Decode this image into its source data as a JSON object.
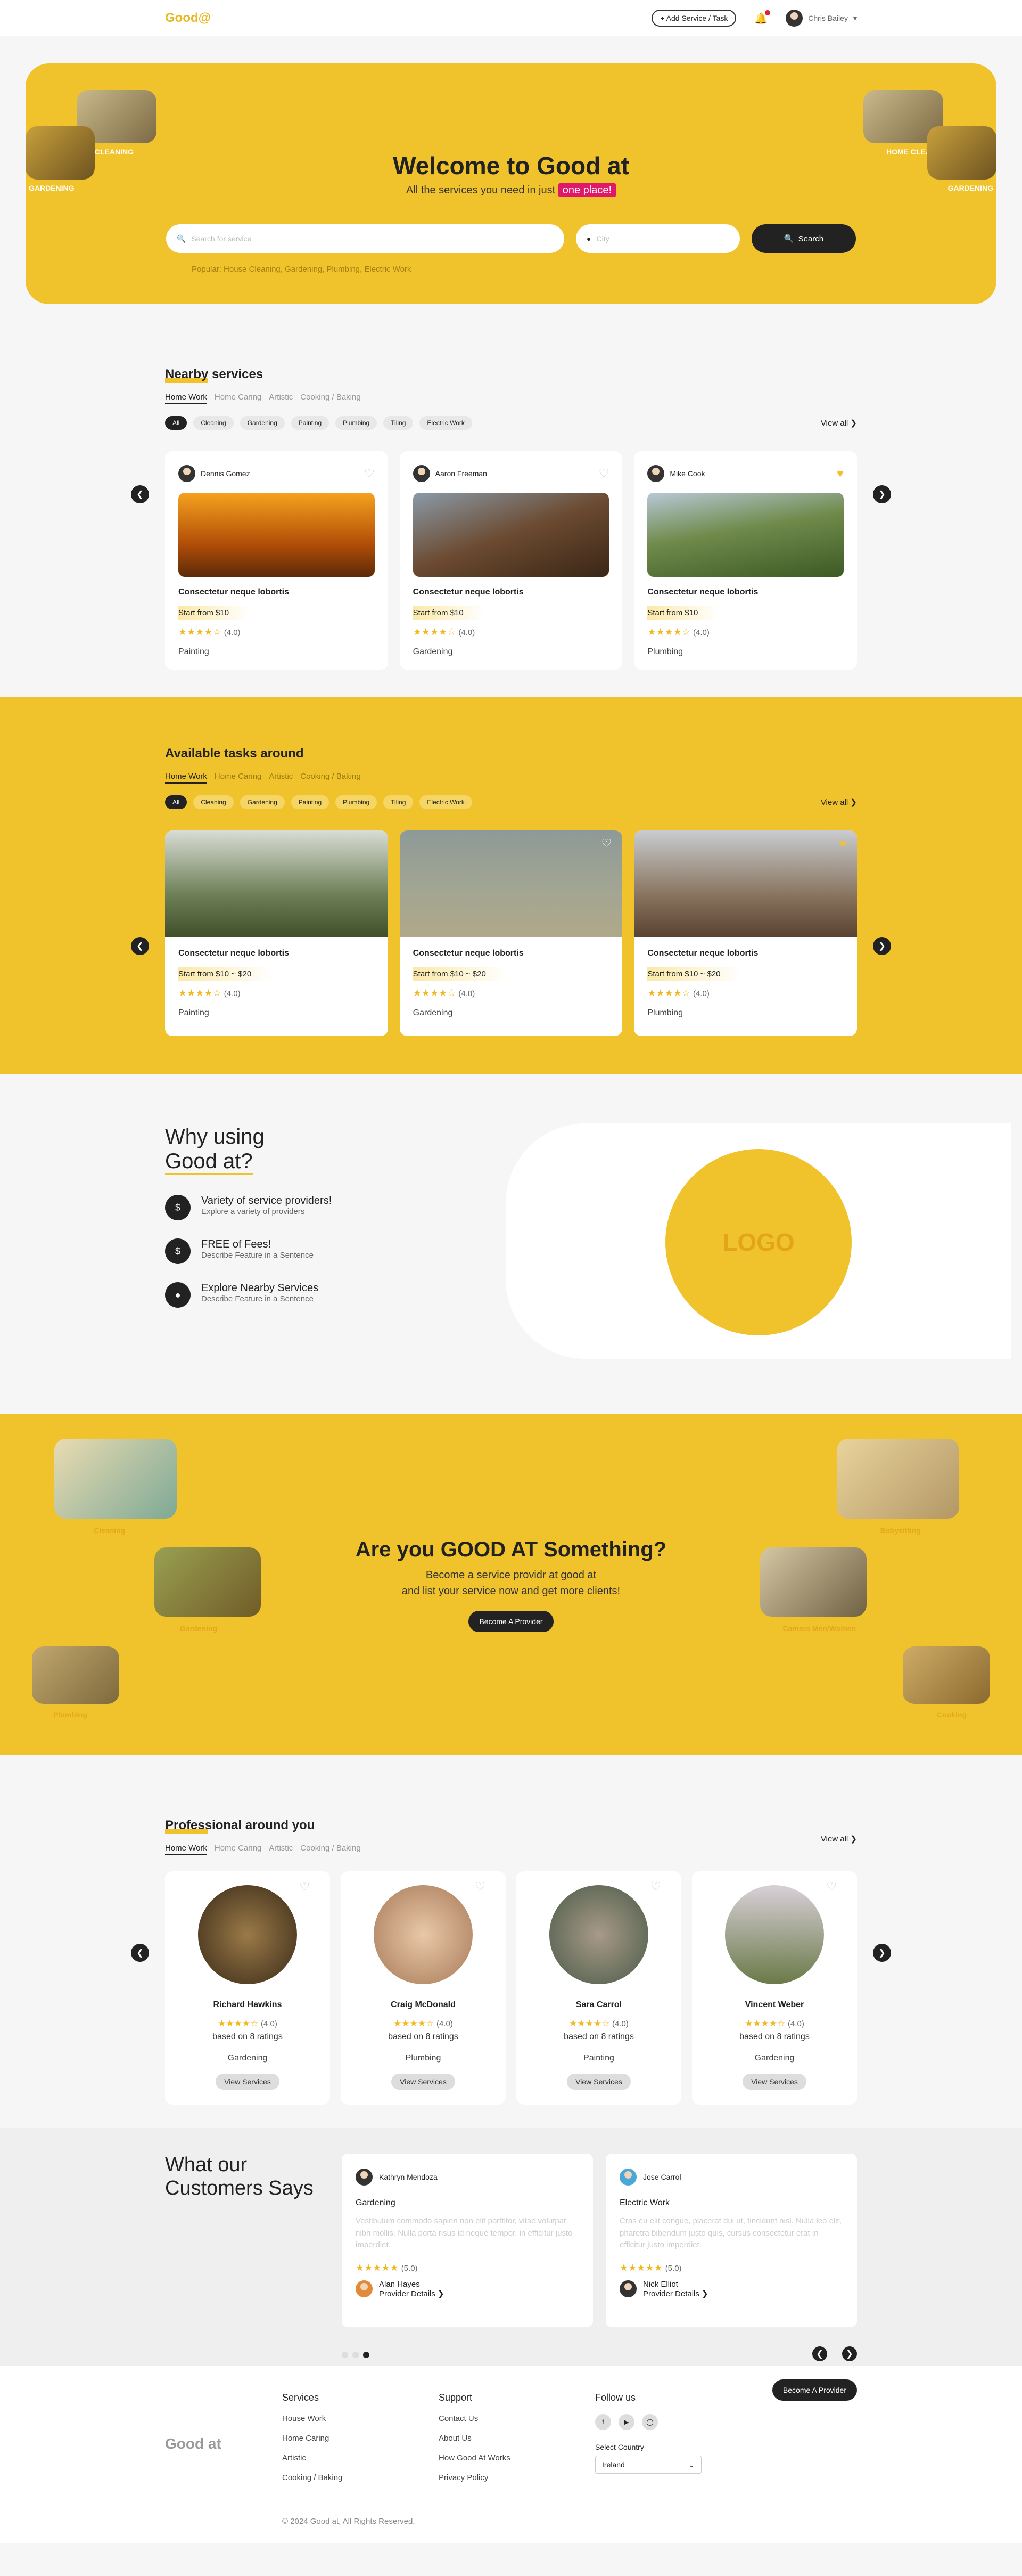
{
  "header": {
    "logo": "Good@",
    "add_service": "+ Add Service / Task",
    "user_name": "Chris Bailey"
  },
  "hero": {
    "title": "Welcome to Good at",
    "subtitle_prefix": "All the services you need in just",
    "subtitle_highlight": "one place!",
    "search_placeholder": "Search for service",
    "city_placeholder": "City",
    "search_button": "Search",
    "popular": "Popular: House Cleaning, Gardening, Plumbing, Electric Work",
    "labels": [
      "HOME CLEANING",
      "GARDENING",
      "HOME CLEANING",
      "GARDENING"
    ]
  },
  "nearby": {
    "title": "Nearby services",
    "tabs": [
      "Home Work",
      "Home Caring",
      "Artistic",
      "Cooking / Baking"
    ],
    "pills": [
      "All",
      "Cleaning",
      "Gardening",
      "Painting",
      "Plumbing",
      "Tiling",
      "Electric Work"
    ],
    "view_all": "View all",
    "cards": [
      {
        "provider": "Dennis Gomez",
        "title": "Consectetur neque lobortis",
        "price": "Start from $10",
        "rating": "(4.0)",
        "category": "Painting",
        "fav": false
      },
      {
        "provider": "Aaron Freeman",
        "title": "Consectetur neque lobortis",
        "price": "Start from $10",
        "rating": "(4.0)",
        "category": "Gardening",
        "fav": false
      },
      {
        "provider": "Mike Cook",
        "title": "Consectetur neque lobortis",
        "price": "Start from $10",
        "rating": "(4.0)",
        "category": "Plumbing",
        "fav": true
      }
    ]
  },
  "tasks": {
    "title": "Available tasks around",
    "tabs": [
      "Home Work",
      "Home Caring",
      "Artistic",
      "Cooking / Baking"
    ],
    "pills": [
      "All",
      "Cleaning",
      "Gardening",
      "Painting",
      "Plumbing",
      "Tiling",
      "Electric Work"
    ],
    "view_all": "View all",
    "cards": [
      {
        "title": "Consectetur neque lobortis",
        "price": "Start from $10 ~ $20",
        "rating": "(4.0)",
        "category": "Painting"
      },
      {
        "title": "Consectetur neque lobortis",
        "price": "Start from $10 ~ $20",
        "rating": "(4.0)",
        "category": "Gardening"
      },
      {
        "title": "Consectetur neque lobortis",
        "price": "Start from $10 ~ $20",
        "rating": "(4.0)",
        "category": "Plumbing"
      }
    ]
  },
  "why": {
    "title_line1": "Why using",
    "title_line2": "Good at?",
    "features": [
      {
        "icon": "$",
        "title": "Variety of service providers!",
        "desc": "Explore a variety of providers"
      },
      {
        "icon": "$",
        "title": "FREE of Fees!",
        "desc": "Describe Feature in a Sentence"
      },
      {
        "icon": "●",
        "title": "Explore Nearby Services",
        "desc": "Describe Feature in a Sentence"
      }
    ],
    "logo_text": "LOGO"
  },
  "goodat": {
    "title": "Are you GOOD AT Something?",
    "line1": "Become a service providr at good at",
    "line2": "and list your service now and get more clients!",
    "button": "Become A Provider",
    "labels": [
      "Cleaning",
      "Gardening",
      "Plumbing",
      "Babysitting",
      "Camera Men/Women",
      "Cooking"
    ]
  },
  "pros": {
    "title": "Professional around you",
    "tabs": [
      "Home Work",
      "Home Caring",
      "Artistic",
      "Cooking / Baking"
    ],
    "view_all": "View all",
    "cards": [
      {
        "name": "Richard Hawkins",
        "rating": "(4.0)",
        "based": "based on 8 ratings",
        "category": "Gardening",
        "button": "View Services"
      },
      {
        "name": "Craig McDonald",
        "rating": "(4.0)",
        "based": "based on 8 ratings",
        "category": "Plumbing",
        "button": "View Services"
      },
      {
        "name": "Sara Carrol",
        "rating": "(4.0)",
        "based": "based on 8 ratings",
        "category": "Painting",
        "button": "View Services"
      },
      {
        "name": "Vincent Weber",
        "rating": "(4.0)",
        "based": "based on 8 ratings",
        "category": "Gardening",
        "button": "View Services"
      }
    ]
  },
  "testimonials": {
    "title_line1": "What our",
    "title_line2": "Customers Says",
    "items": [
      {
        "name": "Kathryn Mendoza",
        "category": "Gardening",
        "text": "Vestibulum commodo sapien non elit porttitor, vitae volutpat nibh mollis. Nulla porta risus id neque tempor, in efficitur justo imperdiet.",
        "rating": "(5.0)",
        "provider": "Alan Hayes",
        "details": "Provider Details"
      },
      {
        "name": "Jose Carrol",
        "category": "Electric Work",
        "text": "Cras eu elit congue, placerat dui ut, tincidunt nisl. Nulla leo elit, pharetra bibendum justo quis, cursus consectetur erat in efficitur justo imperdiet.",
        "rating": "(5.0)",
        "provider": "Nick Elliot",
        "details": "Provider Details"
      }
    ]
  },
  "footer": {
    "brand": "Good at",
    "services_title": "Services",
    "services": [
      "House Work",
      "Home Caring",
      "Artistic",
      "Cooking / Baking"
    ],
    "support_title": "Support",
    "support": [
      "Contact Us",
      "About Us",
      "How Good At Works",
      "Privacy Policy"
    ],
    "follow_title": "Follow us",
    "select_country": "Select Country",
    "country": "Ireland",
    "become": "Become A Provider",
    "copyright": "© 2024 Good at, All Rights Reserved."
  }
}
